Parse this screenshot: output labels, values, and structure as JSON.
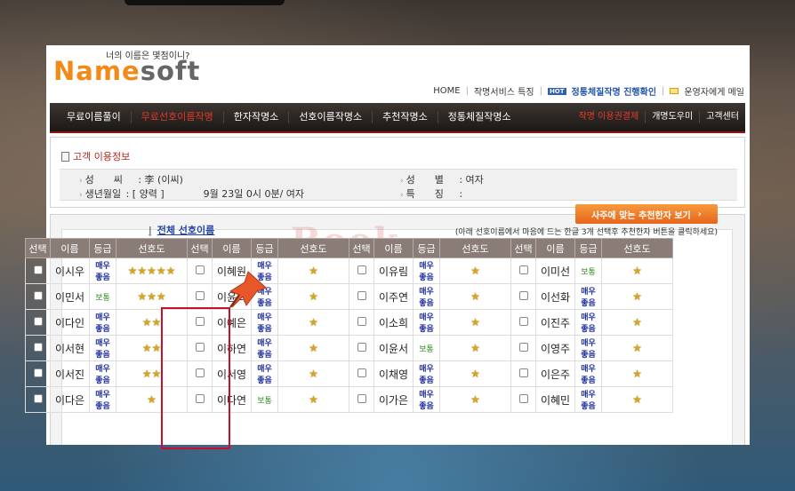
{
  "header": {
    "tagline": "너의 이름은 몇점이니?",
    "logo_name": "Name",
    "logo_soft": "soft",
    "links": [
      "HOME",
      "작명서비스 특징",
      "정통체질작명 진행확인",
      "운영자에게 메일"
    ],
    "hot_badge": "HOT"
  },
  "nav": {
    "items": [
      "무료이름풀이",
      "무료선호이름작명",
      "한자작명소",
      "선호이름작명소",
      "추천작명소",
      "정통체질작명소"
    ],
    "right_items": [
      "작명 이용권결제",
      "개명도우미",
      "고객센터"
    ]
  },
  "info": {
    "title": "고객 이용정보",
    "surname_label": "성　　씨",
    "surname_value": ": 李 (이씨)",
    "birth_label": "생년월일",
    "birth_value": ": [ 양력 ]　　　　9월 23일 0시 0분/ 여자",
    "gender_label": "성　　별",
    "gender_value": ": 여자",
    "feature_label": "특　　징",
    "feature_value": ":"
  },
  "watermark": "Book",
  "recommend_button": "사주에 맞는 추천한자 보기",
  "all_link": "전체 선호이름",
  "all_link_bar": "|",
  "help_text": "(아래 선호이름에서 마음에 드는 한글 3개 선택후 추천한자 버튼을 클릭하세요)",
  "table": {
    "headers": [
      "선택",
      "이름",
      "등급",
      "선호도"
    ],
    "columns": [
      [
        {
          "name": "이시우",
          "grade": "매우좋음",
          "stars": 5
        },
        {
          "name": "이민서",
          "grade": "보통",
          "stars": 3
        },
        {
          "name": "이다인",
          "grade": "매우좋음",
          "stars": 2
        },
        {
          "name": "이서현",
          "grade": "매우좋음",
          "stars": 2
        },
        {
          "name": "이서진",
          "grade": "매우좋음",
          "stars": 2
        },
        {
          "name": "이다은",
          "grade": "매우좋음",
          "stars": 1
        }
      ],
      [
        {
          "name": "이혜원",
          "grade": "매우좋음",
          "stars": 1
        },
        {
          "name": "이윤희",
          "grade": "매우좋음",
          "stars": 1
        },
        {
          "name": "이예은",
          "grade": "매우좋음",
          "stars": 1
        },
        {
          "name": "이하연",
          "grade": "매우좋음",
          "stars": 1
        },
        {
          "name": "이서영",
          "grade": "매우좋음",
          "stars": 1
        },
        {
          "name": "이다연",
          "grade": "보통",
          "stars": 1
        }
      ],
      [
        {
          "name": "이유림",
          "grade": "매우좋음",
          "stars": 1
        },
        {
          "name": "이주연",
          "grade": "매우좋음",
          "stars": 1
        },
        {
          "name": "이소희",
          "grade": "매우좋음",
          "stars": 1
        },
        {
          "name": "이윤서",
          "grade": "보통",
          "stars": 1
        },
        {
          "name": "이채영",
          "grade": "매우좋음",
          "stars": 1
        },
        {
          "name": "이가은",
          "grade": "매우좋음",
          "stars": 1
        }
      ],
      [
        {
          "name": "이미선",
          "grade": "보통",
          "stars": 1
        },
        {
          "name": "이선화",
          "grade": "매우좋음",
          "stars": 1
        },
        {
          "name": "이진주",
          "grade": "매우좋음",
          "stars": 1
        },
        {
          "name": "이영주",
          "grade": "매우좋음",
          "stars": 1
        },
        {
          "name": "이은주",
          "grade": "매우좋음",
          "stars": 1
        },
        {
          "name": "이혜민",
          "grade": "매우좋음",
          "stars": 1
        }
      ]
    ]
  },
  "colors": {
    "accent_orange": "#f28a1a",
    "nav_bg": "#2a2420",
    "nav_red": "#e8372a",
    "highlight": "#c8102e",
    "table_header": "#8a7d78",
    "grade_good": "#1f2f9a",
    "grade_ok": "#2f8a20",
    "star": "#d8a520"
  },
  "icons": [
    "mail-icon",
    "clipboard-icon",
    "pushpin-icon",
    "star-icon",
    "chevron-right-icon"
  ]
}
